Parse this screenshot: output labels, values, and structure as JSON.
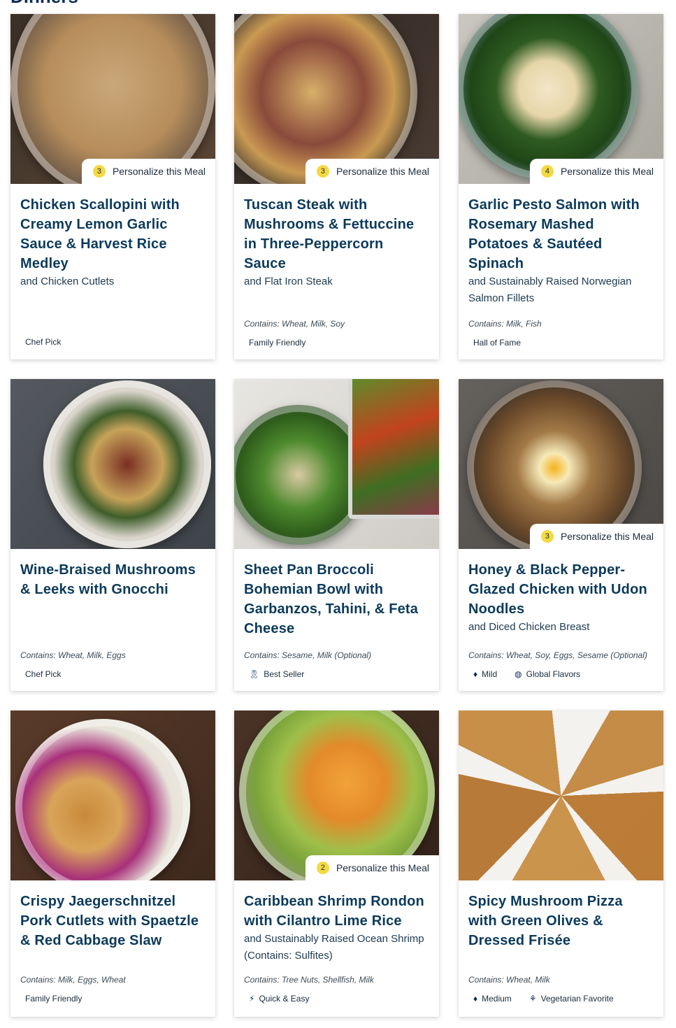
{
  "section": {
    "title": "Dinners"
  },
  "personalize_label": "Personalize this Meal",
  "meals": [
    {
      "title": "Chicken Scallopini with Creamy Lemon Garlic Sauce & Harvest Rice Medley",
      "subtitle": "and Chicken Cutlets",
      "contains": "",
      "personalize_count": "3",
      "tags": [
        {
          "icon": "none",
          "label": "Chef Pick"
        }
      ]
    },
    {
      "title": "Tuscan Steak with Mushrooms & Fettuccine in Three-Peppercorn Sauce",
      "subtitle": "and Flat Iron Steak",
      "contains": "Contains: Wheat, Milk, Soy",
      "personalize_count": "3",
      "tags": [
        {
          "icon": "none",
          "label": "Family Friendly"
        }
      ]
    },
    {
      "title": "Garlic Pesto Salmon with Rosemary Mashed Potatoes & Sautéed Spinach",
      "subtitle": "and Sustainably Raised Norwegian Salmon Fillets",
      "contains": "Contains: Milk, Fish",
      "personalize_count": "4",
      "tags": [
        {
          "icon": "none",
          "label": "Hall of Fame"
        }
      ]
    },
    {
      "title": "Wine-Braised Mushrooms & Leeks with Gnocchi",
      "subtitle": "",
      "contains": "Contains: Wheat, Milk, Eggs",
      "personalize_count": "",
      "tags": [
        {
          "icon": "none",
          "label": "Chef Pick"
        }
      ]
    },
    {
      "title": "Sheet Pan Broccoli Bohemian Bowl with Garbanzos, Tahini, & Feta Cheese",
      "subtitle": "",
      "contains": "Contains: Sesame, Milk (Optional)",
      "personalize_count": "",
      "tags": [
        {
          "icon": "ribbon-icon",
          "label": "Best Seller"
        }
      ]
    },
    {
      "title": "Honey & Black Pepper-Glazed Chicken with Udon Noodles",
      "subtitle": "and Diced Chicken Breast",
      "contains": "Contains: Wheat, Soy, Eggs, Sesame (Optional)",
      "personalize_count": "3",
      "tags": [
        {
          "icon": "pepper-icon",
          "label": "Mild"
        },
        {
          "icon": "globe-icon",
          "label": "Global Flavors"
        }
      ]
    },
    {
      "title": "Crispy Jaegerschnitzel Pork Cutlets with Spaetzle & Red Cabbage Slaw",
      "subtitle": "",
      "contains": "Contains: Milk, Eggs, Wheat",
      "personalize_count": "",
      "tags": [
        {
          "icon": "none",
          "label": "Family Friendly"
        }
      ]
    },
    {
      "title": "Caribbean Shrimp Rondon with Cilantro Lime Rice",
      "subtitle": "and Sustainably Raised Ocean Shrimp (Contains: Sulfites)",
      "contains": "Contains: Tree Nuts, Shellfish, Milk",
      "personalize_count": "2",
      "tags": [
        {
          "icon": "lightning-icon",
          "label": "Quick & Easy"
        }
      ]
    },
    {
      "title": "Spicy Mushroom Pizza with Green Olives & Dressed Frisée",
      "subtitle": "",
      "contains": "Contains: Wheat, Milk",
      "personalize_count": "",
      "tags": [
        {
          "icon": "pepper-icon",
          "label": "Medium"
        },
        {
          "icon": "sprout-icon",
          "label": "Vegetarian Favorite"
        }
      ]
    }
  ],
  "colors": {
    "brand_navy": "#0b3a5c",
    "badge_yellow": "#f5d943"
  }
}
